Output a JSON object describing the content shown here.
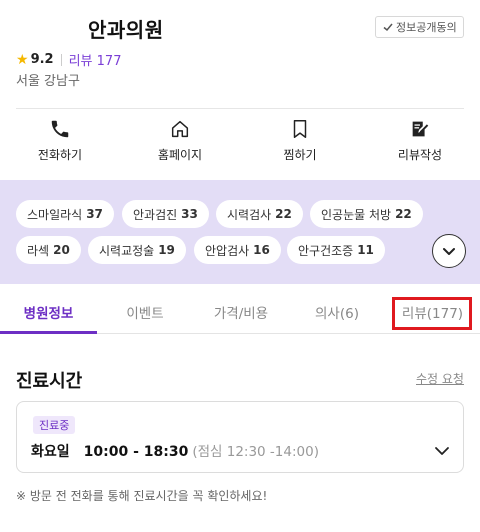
{
  "header": {
    "clinic_name": "안과의원",
    "consent_label": "정보공개동의",
    "rating": "9.2",
    "review_label": "리뷰 177",
    "location": "서울 강남구"
  },
  "actions": [
    {
      "label": "전화하기",
      "icon": "phone-icon"
    },
    {
      "label": "홈페이지",
      "icon": "home-icon"
    },
    {
      "label": "찜하기",
      "icon": "bookmark-icon"
    },
    {
      "label": "리뷰작성",
      "icon": "edit-icon"
    }
  ],
  "tags": [
    {
      "name": "스마일라식",
      "count": "37"
    },
    {
      "name": "안과검진",
      "count": "33"
    },
    {
      "name": "시력검사",
      "count": "22"
    },
    {
      "name": "인공눈물 처방",
      "count": "22"
    },
    {
      "name": "라섹",
      "count": "20"
    },
    {
      "name": "시력교정술",
      "count": "19"
    },
    {
      "name": "안압검사",
      "count": "16"
    },
    {
      "name": "안구건조증",
      "count": "11"
    }
  ],
  "tabs": [
    {
      "label": "병원정보",
      "active": true
    },
    {
      "label": "이벤트",
      "active": false
    },
    {
      "label": "가격/비용",
      "active": false
    },
    {
      "label": "의사(6)",
      "active": false
    },
    {
      "label": "리뷰(177)",
      "active": false
    }
  ],
  "hours": {
    "section_title": "진료시간",
    "edit_label": "수정 요청",
    "status": "진료중",
    "day": "화요일",
    "time": "10:00 - 18:30",
    "lunch": "(점심 12:30 -14:00)",
    "notice": "※ 방문 전 전화를 통해 진료시간을 꼭 확인하세요!"
  },
  "colors": {
    "accent": "#6d2fc4",
    "tag_panel_bg": "#e3ddf6",
    "highlight_red": "#e0191f",
    "star": "#f5b800"
  }
}
